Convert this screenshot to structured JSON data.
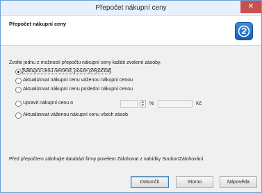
{
  "window": {
    "title": "Přepočet nákupní ceny",
    "close_glyph": "✕"
  },
  "header": {
    "title": "Přepočet nákupní ceny",
    "logo_icon": "app-logo-icon"
  },
  "intro_text": "Zvolte jednu z možností přepočtu nákupní ceny každé zvolené zásoby.",
  "options": [
    {
      "label": "Nákupní cenu neměnit, pouze přepočítat",
      "checked": true
    },
    {
      "label": "Aktualizovat nákupní cenu váženou nákupní cenou",
      "checked": false
    },
    {
      "label": "Aktualizovat nákupní cenu poslední nákupní cenou",
      "checked": false
    },
    {
      "label": "Upravit nákupní cenu o",
      "checked": false
    },
    {
      "label": "Aktualizovat váženou nákupní cenu všech zásob",
      "checked": false
    }
  ],
  "adjust": {
    "percent_value": "",
    "percent_unit": "%",
    "amount_value": "",
    "currency_unit": "Kč"
  },
  "footer_note": "Před přepočtem zálohujte databázi firmy povelem Zálohovat z nabídky Soubor/Zálohování.",
  "buttons": {
    "finish": "Dokončit",
    "cancel": "Storno",
    "help": "Nápověda"
  },
  "colors": {
    "title_bar": "#e8f1fb",
    "close_button": "#c75050",
    "logo": "#1660b8"
  }
}
